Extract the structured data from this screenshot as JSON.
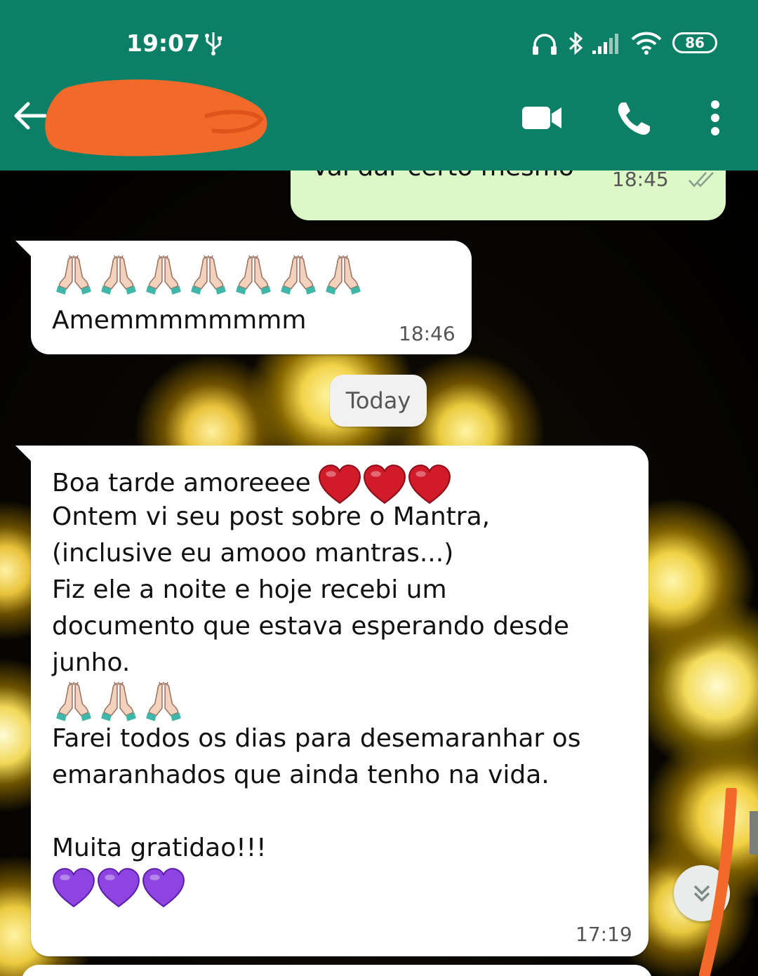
{
  "status_bar": {
    "time": "19:07",
    "battery": "86",
    "icons": [
      "usb-icon",
      "headset-icon",
      "bluetooth-icon",
      "signal-icon",
      "wifi-icon",
      "battery-icon"
    ]
  },
  "header": {
    "contact_name": "",
    "icons": [
      "back-arrow-icon",
      "video-call-icon",
      "voice-call-icon",
      "more-options-icon"
    ],
    "accent_color": "#0c8066"
  },
  "messages": [
    {
      "direction": "outgoing",
      "text": "Vai dar certo mesmo",
      "time": "18:45",
      "status": "read"
    },
    {
      "direction": "incoming",
      "emoji_count": 7,
      "emoji": "folded-hands",
      "text": "Amemmmmmmmm",
      "time": "18:46"
    },
    {
      "type": "date_separator",
      "text": "Today"
    },
    {
      "direction": "incoming",
      "lines": [
        "Boa tarde amoreeee",
        "Ontem vi seu post sobre o Mantra,",
        "(inclusive eu amooo mantras...)",
        "Fiz ele a noite e hoje recebi um",
        "documento que estava esperando desde",
        "junho.",
        "",
        "Farei todos os dias para desemaranhar os",
        "emaranhados que ainda tenho na vida.",
        "",
        "Muita gratidao!!!"
      ],
      "heart_emoji_count": 3,
      "hand_emoji_count": 3,
      "purple_heart_count": 3,
      "time": "17:19"
    }
  ],
  "colors": {
    "incoming_bubble": "#ffffff",
    "outgoing_bubble": "#dcf8c6",
    "header": "#0c8066",
    "redaction": "#f26a2a"
  }
}
